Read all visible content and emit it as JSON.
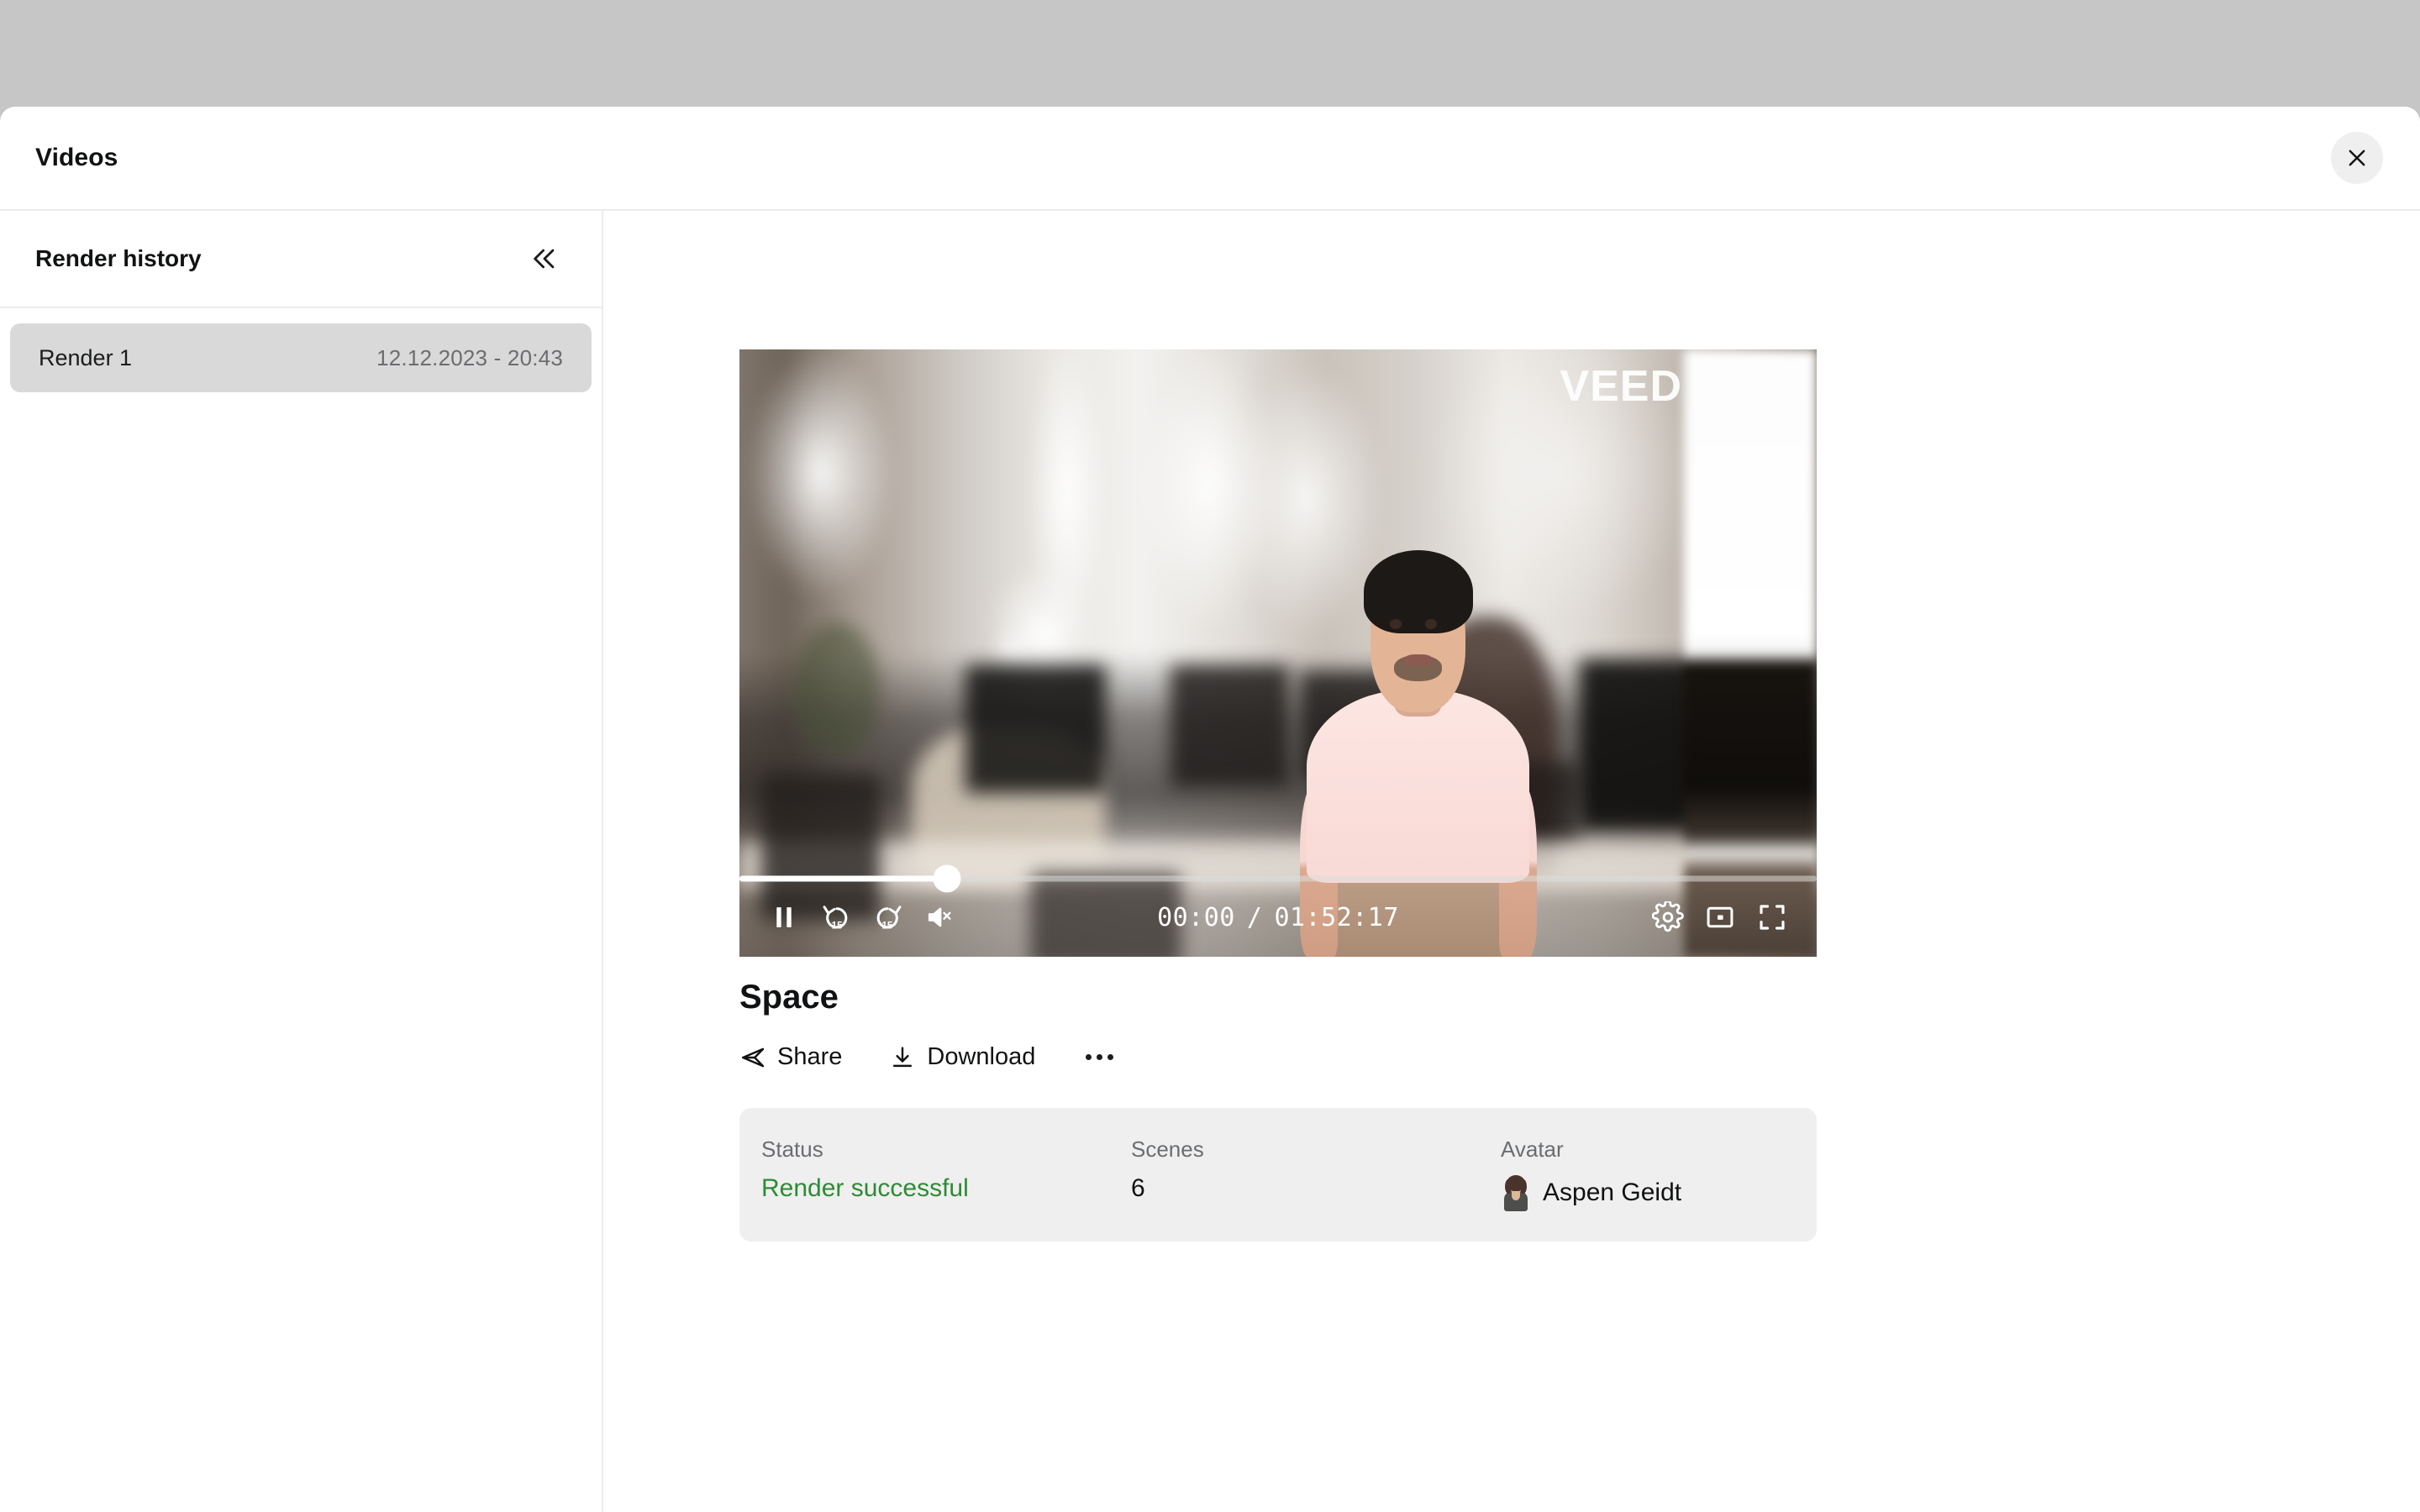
{
  "modal": {
    "title": "Videos",
    "close_label": "Close",
    "close_icon": "close-icon"
  },
  "sidebar": {
    "header_title": "Render history",
    "collapse_icon": "chevrons-left-icon",
    "renders": [
      {
        "name": "Render 1",
        "date": "12.12.2023 - 20:43",
        "selected": true
      }
    ]
  },
  "player": {
    "watermark": "VEED",
    "is_playing": true,
    "is_muted": true,
    "progress_percent": 19.3,
    "current_time": "00:00",
    "time_separator": "/",
    "duration": "01:52:17",
    "controls": {
      "pause_label": "Pause",
      "rewind_label": "15",
      "forward_label": "15",
      "mute_label": "Unmute",
      "settings_label": "Settings",
      "pip_label": "Picture in picture",
      "fullscreen_label": "Fullscreen"
    }
  },
  "video": {
    "title": "Space",
    "actions": {
      "share": "Share",
      "download": "Download",
      "more": "More options"
    }
  },
  "stats": {
    "status": {
      "label": "Status",
      "value": "Render successful",
      "color": "#2e8b34"
    },
    "scenes": {
      "label": "Scenes",
      "value": "6"
    },
    "avatar": {
      "label": "Avatar",
      "value": "Aspen Geidt"
    }
  }
}
